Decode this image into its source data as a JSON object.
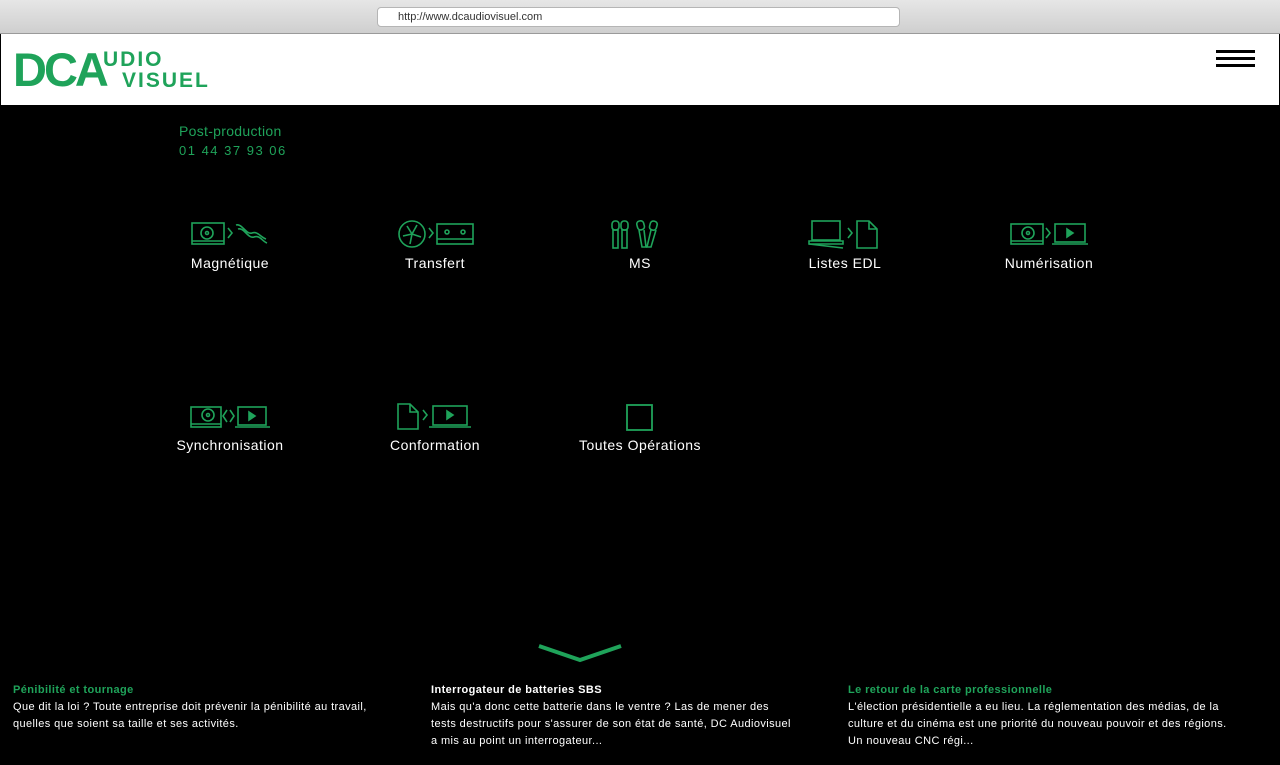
{
  "browser": {
    "url": "http://www.dcaudiovisuel.com"
  },
  "logo": {
    "dca": "DCA",
    "audio": "UDIO",
    "visuel": "VISUEL"
  },
  "colors": {
    "accent": "#1fa35a",
    "background": "#000000",
    "header_bg": "#ffffff",
    "text": "#ffffff"
  },
  "section": {
    "title": "Post-production",
    "phone": "01 44 37 93 06"
  },
  "services": [
    {
      "label": "Magnétique",
      "icon": "reel-to-cable-icon"
    },
    {
      "label": "Transfert",
      "icon": "reel-to-cassette-icon"
    },
    {
      "label": "MS",
      "icon": "microphones-icon"
    },
    {
      "label": "Listes EDL",
      "icon": "laptop-to-document-icon"
    },
    {
      "label": "Numérisation",
      "icon": "reel-to-laptop-icon"
    },
    {
      "label": "Synchronisation",
      "icon": "reel-sync-laptop-icon"
    },
    {
      "label": "Conformation",
      "icon": "document-to-laptop-icon"
    },
    {
      "label": "Toutes Opérations",
      "icon": "square-icon"
    }
  ],
  "scroll_icon": "chevron-down-icon",
  "news": [
    {
      "title": "Pénibilité et tournage",
      "title_color": "#1fa35a",
      "text": "Que dit la loi ? Toute entreprise doit prévenir la pénibilité au travail, quelles que soient sa taille et ses activités."
    },
    {
      "title": "Interrogateur de batteries SBS",
      "title_color": "#ffffff",
      "text": "Mais qu'a donc cette batterie dans le ventre ? Las de mener des tests destructifs pour s'assurer de son état de santé, DC Audiovisuel a mis au point un interrogateur..."
    },
    {
      "title": "Le retour de la carte professionnelle",
      "title_color": "#1fa35a",
      "text": "L'élection présidentielle a eu lieu. La réglementation des médias, de la culture et du cinéma est une priorité du nouveau pouvoir et des régions. Un nouveau CNC régi..."
    }
  ]
}
